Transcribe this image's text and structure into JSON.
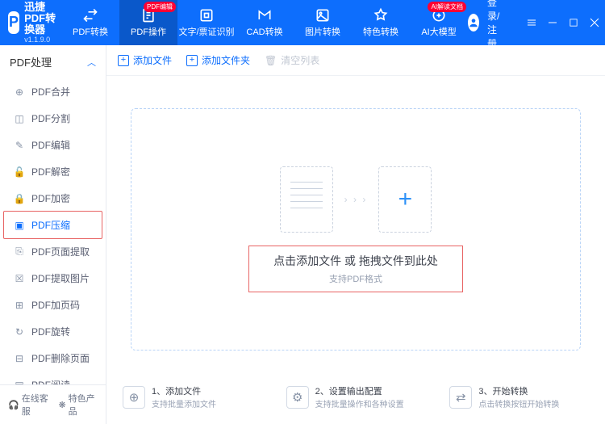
{
  "app": {
    "name": "迅捷PDF转换器",
    "version": "v1.1.9.0"
  },
  "nav": {
    "items": [
      {
        "label": "PDF转换",
        "badge": ""
      },
      {
        "label": "PDF操作",
        "badge": "PDF编辑"
      },
      {
        "label": "文字/票证识别",
        "badge": ""
      },
      {
        "label": "CAD转换",
        "badge": ""
      },
      {
        "label": "图片转换",
        "badge": ""
      },
      {
        "label": "特色转换",
        "badge": ""
      },
      {
        "label": "AI大模型",
        "badge": "AI解读文档"
      }
    ],
    "login": "登录/注册"
  },
  "sidebar": {
    "header": "PDF处理",
    "items": [
      "PDF合并",
      "PDF分割",
      "PDF编辑",
      "PDF解密",
      "PDF加密",
      "PDF压缩",
      "PDF页面提取",
      "PDF提取图片",
      "PDF加页码",
      "PDF旋转",
      "PDF删除页面",
      "PDF阅读"
    ],
    "footer": {
      "support": "在线客服",
      "featured": "特色产品"
    }
  },
  "toolbar": {
    "addFile": "添加文件",
    "addFolder": "添加文件夹",
    "clear": "清空列表"
  },
  "drop": {
    "title": "点击添加文件 或 拖拽文件到此处",
    "sub": "支持PDF格式"
  },
  "steps": [
    {
      "title": "1、添加文件",
      "sub": "支持批量添加文件"
    },
    {
      "title": "2、设置输出配置",
      "sub": "支持批量操作和各种设置"
    },
    {
      "title": "3、开始转换",
      "sub": "点击转换按钮开始转换"
    }
  ]
}
